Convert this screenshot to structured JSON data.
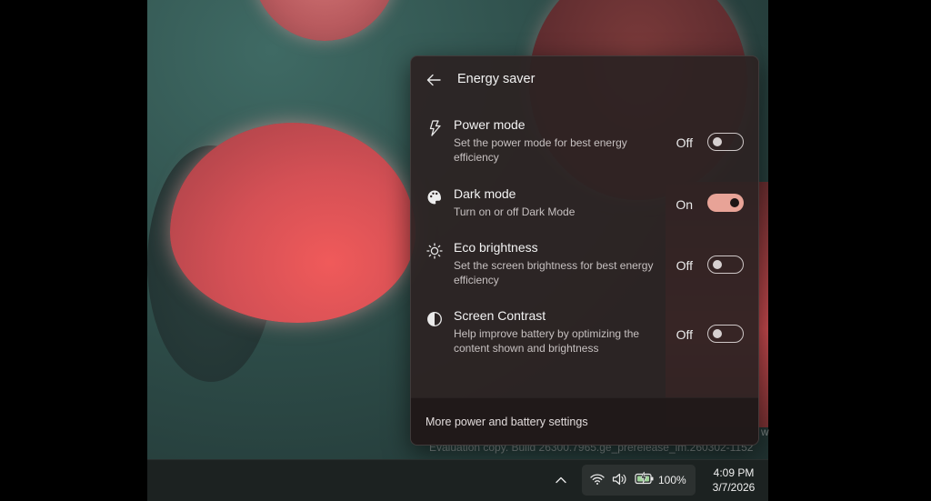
{
  "flyout": {
    "title": "Energy saver",
    "settings": [
      {
        "icon": "lightning-icon",
        "name": "Power mode",
        "description": "Set the power mode for best energy efficiency",
        "state": "Off",
        "on": false
      },
      {
        "icon": "palette-icon",
        "name": "Dark mode",
        "description": "Turn on or off Dark Mode",
        "state": "On",
        "on": true
      },
      {
        "icon": "sun-icon",
        "name": "Eco brightness",
        "description": "Set the screen brightness for best energy efficiency",
        "state": "Off",
        "on": false
      },
      {
        "icon": "contrast-icon",
        "name": "Screen Contrast",
        "description": "Help improve battery by optimizing the content shown and brightness",
        "state": "Off",
        "on": false
      }
    ],
    "footer_link": "More power and battery settings"
  },
  "desktop": {
    "watermark": "Evaluation copy. Build 26300.7965.ge_prerelease_im.260302-1152",
    "watermark_tail": "w"
  },
  "taskbar": {
    "battery_percent": "100%",
    "time": "4:09 PM",
    "date": "3/7/2026"
  },
  "colors": {
    "toggle_on": "#e8a397",
    "flyout_bg": "#2c2222",
    "taskbar_bg": "#1c2221"
  }
}
